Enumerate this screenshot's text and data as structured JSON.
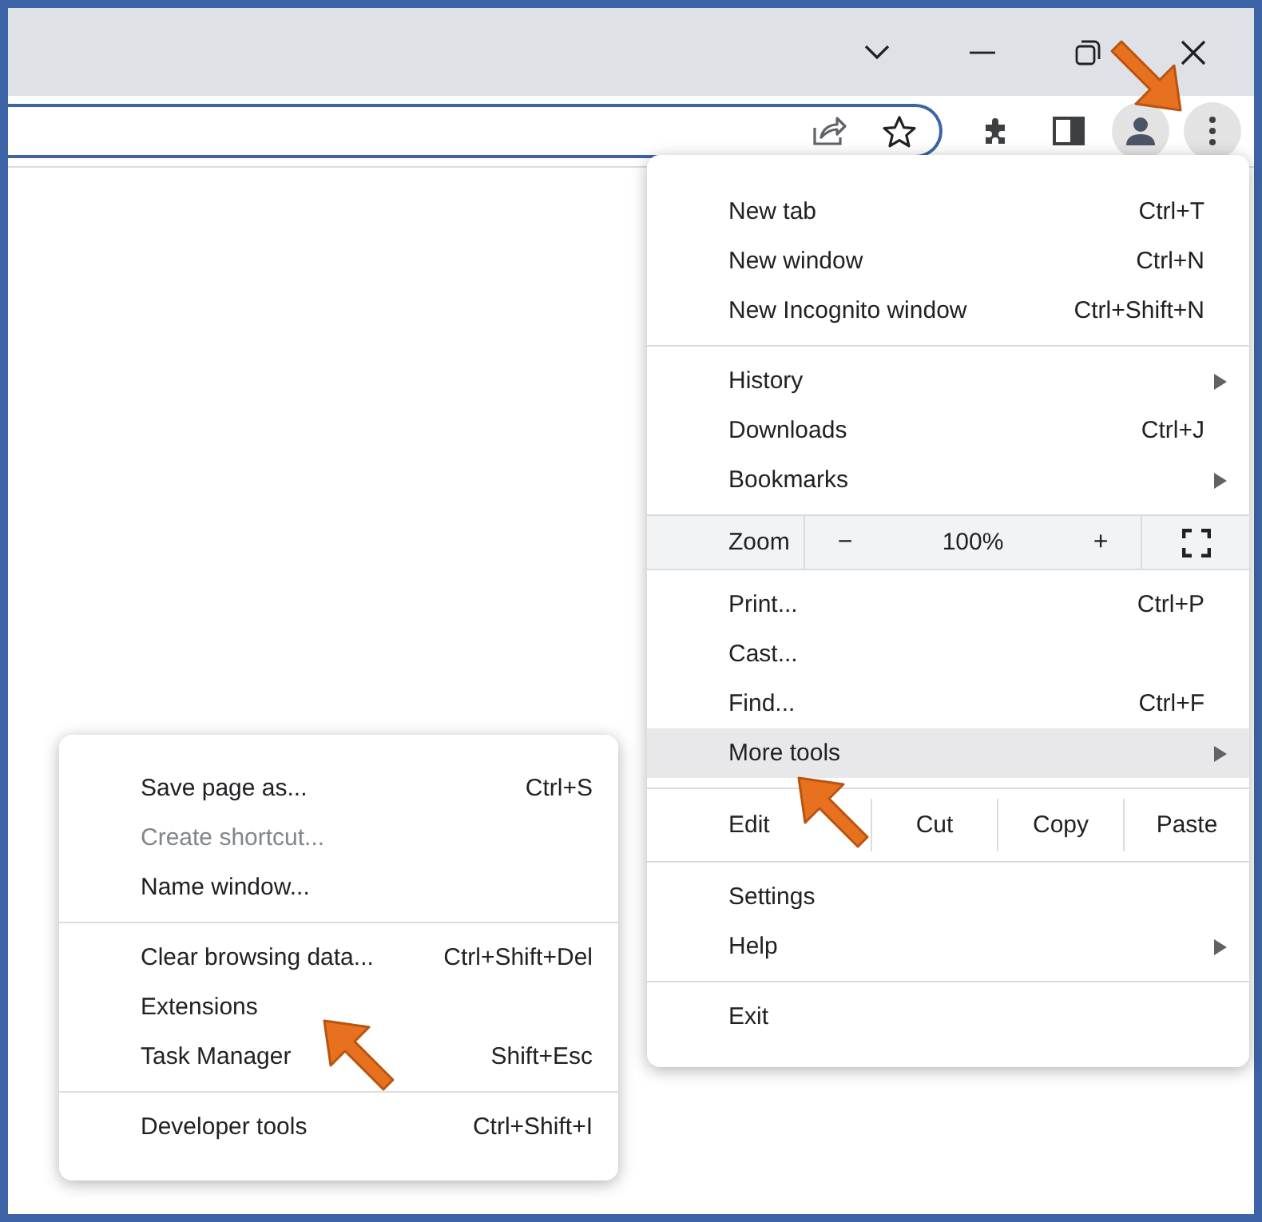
{
  "main_menu": {
    "groups": [
      [
        {
          "kind": "item",
          "label": "New tab",
          "shortcut": "Ctrl+T",
          "has_submenu": false,
          "selected": false
        },
        {
          "kind": "item",
          "label": "New window",
          "shortcut": "Ctrl+N",
          "has_submenu": false,
          "selected": false
        },
        {
          "kind": "item",
          "label": "New Incognito window",
          "shortcut": "Ctrl+Shift+N",
          "has_submenu": false,
          "selected": false
        }
      ],
      [
        {
          "kind": "item",
          "label": "History",
          "has_submenu": true,
          "selected": false
        },
        {
          "kind": "item",
          "label": "Downloads",
          "shortcut": "Ctrl+J",
          "has_submenu": false,
          "selected": false
        },
        {
          "kind": "item",
          "label": "Bookmarks",
          "has_submenu": true,
          "selected": false
        }
      ],
      [
        {
          "kind": "zoom",
          "label": "Zoom",
          "minus": "−",
          "value": "100%",
          "plus": "+"
        }
      ],
      [
        {
          "kind": "item",
          "label": "Print...",
          "shortcut": "Ctrl+P",
          "has_submenu": false,
          "selected": false
        },
        {
          "kind": "item",
          "label": "Cast...",
          "has_submenu": false,
          "selected": false
        },
        {
          "kind": "item",
          "label": "Find...",
          "shortcut": "Ctrl+F",
          "has_submenu": false,
          "selected": false
        },
        {
          "kind": "item",
          "label": "More tools",
          "has_submenu": true,
          "selected": true
        }
      ],
      [
        {
          "kind": "edit",
          "label": "Edit",
          "buttons": [
            "Cut",
            "Copy",
            "Paste"
          ]
        }
      ],
      [
        {
          "kind": "item",
          "label": "Settings",
          "has_submenu": false,
          "selected": false
        },
        {
          "kind": "item",
          "label": "Help",
          "has_submenu": true,
          "selected": false
        }
      ],
      [
        {
          "kind": "item",
          "label": "Exit",
          "has_submenu": false,
          "selected": false
        }
      ]
    ]
  },
  "submenu": {
    "groups": [
      [
        {
          "label": "Save page as...",
          "shortcut": "Ctrl+S",
          "disabled": false
        },
        {
          "label": "Create shortcut...",
          "disabled": true
        },
        {
          "label": "Name window...",
          "disabled": false
        }
      ],
      [
        {
          "label": "Clear browsing data...",
          "shortcut": "Ctrl+Shift+Del",
          "disabled": false
        },
        {
          "label": "Extensions",
          "disabled": false
        },
        {
          "label": "Task Manager",
          "shortcut": "Shift+Esc",
          "disabled": false
        }
      ],
      [
        {
          "label": "Developer tools",
          "shortcut": "Ctrl+Shift+I",
          "disabled": false
        }
      ]
    ]
  }
}
